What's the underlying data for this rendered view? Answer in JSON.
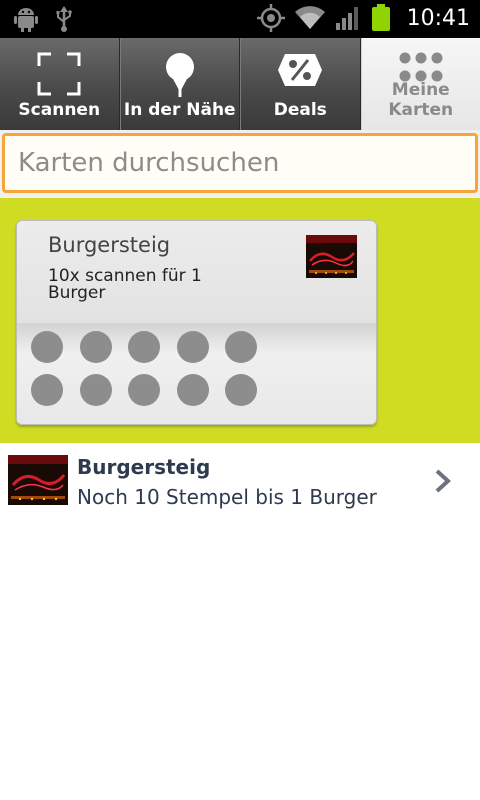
{
  "status_bar": {
    "time": "10:41",
    "icons_left": [
      "android-debug-icon",
      "usb-icon"
    ],
    "icons_right": [
      "gps-icon",
      "wifi-icon",
      "signal-icon",
      "battery-icon"
    ]
  },
  "tabs": [
    {
      "label": "Scannen",
      "icon": "scan-frame-icon",
      "active": false
    },
    {
      "label": "In der Nähe",
      "icon": "map-pin-icon",
      "active": false
    },
    {
      "label": "Deals",
      "icon": "percent-tag-icon",
      "active": false
    },
    {
      "label": "Meine Karten",
      "icon": "grid-dots-icon",
      "active": true
    }
  ],
  "search": {
    "placeholder": "Karten durchsuchen",
    "value": ""
  },
  "loyalty_card": {
    "title": "Burgersteig",
    "description": "10x scannen für 1 Burger",
    "logo_text": "Burgersteig",
    "stamps_total": 10,
    "stamps_collected": 0
  },
  "list": [
    {
      "title": "Burgersteig",
      "subtitle": "Noch 10 Stempel bis 1 Burger",
      "logo_text": "Burgersteig"
    }
  ],
  "colors": {
    "accent_orange": "#f7a43a",
    "card_background_green": "#cfdc22",
    "list_text": "#2e3b4e",
    "stamp_empty": "#8d8d8d",
    "logo_red": "#c8102e"
  }
}
